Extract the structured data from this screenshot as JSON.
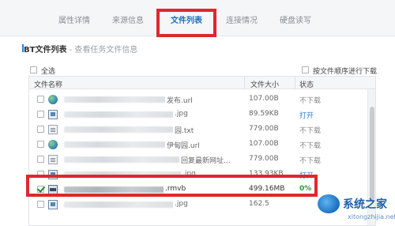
{
  "tabs": [
    {
      "label": "属性详情"
    },
    {
      "label": "来源信息"
    },
    {
      "label": "文件列表"
    },
    {
      "label": "连接情况"
    },
    {
      "label": "硬盘读写"
    }
  ],
  "section": {
    "title": "BT文件列表",
    "subtitle": " - 查看任务文件信息"
  },
  "options": {
    "select_all": "全选",
    "sequential": "按文件顺序进行下载"
  },
  "table": {
    "columns": [
      "文件名称",
      "文件大小",
      "状态"
    ],
    "rows": [
      {
        "icon": "globe-icon",
        "suffix": "发布.url",
        "size": "107.00B",
        "status": "不下载",
        "checked": false
      },
      {
        "icon": "image-file-icon",
        "suffix": ".jpg",
        "size": "89.59KB",
        "status": "打开",
        "checked": false
      },
      {
        "icon": "text-file-icon",
        "suffix": "园.txt",
        "size": "779.00B",
        "status": "不下载",
        "checked": false
      },
      {
        "icon": "globe-icon",
        "suffix": "伊甸园.url",
        "size": "107.00B",
        "status": "不下载",
        "checked": false
      },
      {
        "icon": "text-file-icon",
        "suffix": "回复最新网址...",
        "size": "779.00B",
        "status": "不下载",
        "checked": false
      },
      {
        "icon": "image-file-icon",
        "suffix": ".jpg",
        "size": "133.93KB",
        "status": "打开",
        "checked": false
      },
      {
        "icon": "video-file-icon",
        "suffix": ".rmvb",
        "size": "499.16MB",
        "status": "0%",
        "checked": true
      },
      {
        "icon": "image-file-icon",
        "suffix": ".jpg",
        "size": "162.5",
        "status": "",
        "checked": false
      }
    ]
  },
  "watermark": {
    "brand": "系统之家",
    "url": "xitongzhijia.net"
  },
  "colors": {
    "accent": "#1e6fb8",
    "highlight": "#e0272d",
    "open_link": "#2a7fd4",
    "progress": "#2b9a3a"
  }
}
